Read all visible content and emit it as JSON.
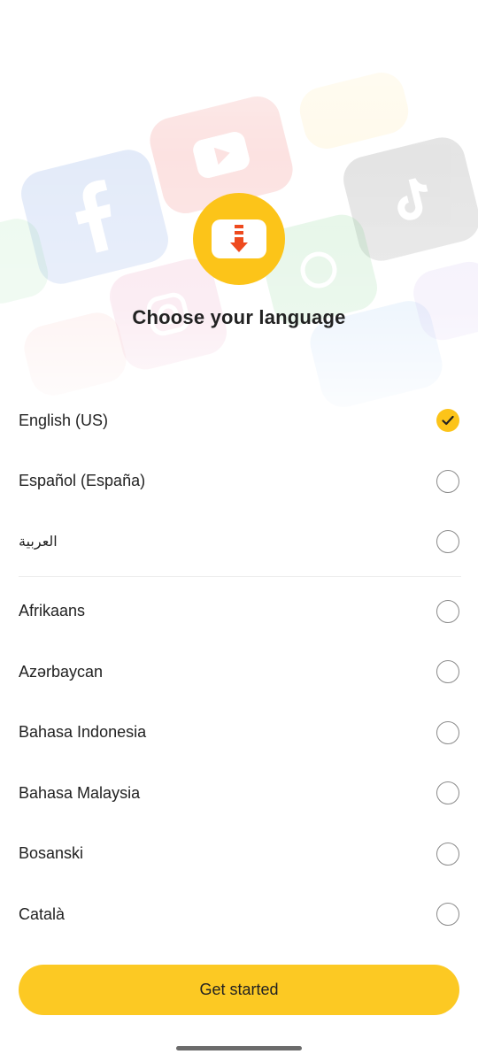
{
  "app": {
    "title": "Choose your language",
    "logo_icon": "download-arrow-icon",
    "accent_color": "#fcc419"
  },
  "background_icons": [
    "facebook-icon",
    "youtube-icon",
    "tiktok-icon",
    "whatsapp-icon",
    "instagram-icon",
    "twitter-icon"
  ],
  "languages": {
    "selected": "English (US)",
    "items": [
      {
        "label": "English (US)",
        "selected": true
      },
      {
        "label": "Español (España)",
        "selected": false
      },
      {
        "label": "العربية",
        "selected": false
      },
      {
        "label": "Afrikaans",
        "selected": false
      },
      {
        "label": "Azərbaycan",
        "selected": false
      },
      {
        "label": "Bahasa Indonesia",
        "selected": false
      },
      {
        "label": "Bahasa Malaysia",
        "selected": false
      },
      {
        "label": "Bosanski",
        "selected": false
      },
      {
        "label": "Català",
        "selected": false
      }
    ]
  },
  "footer": {
    "get_started_label": "Get started"
  }
}
